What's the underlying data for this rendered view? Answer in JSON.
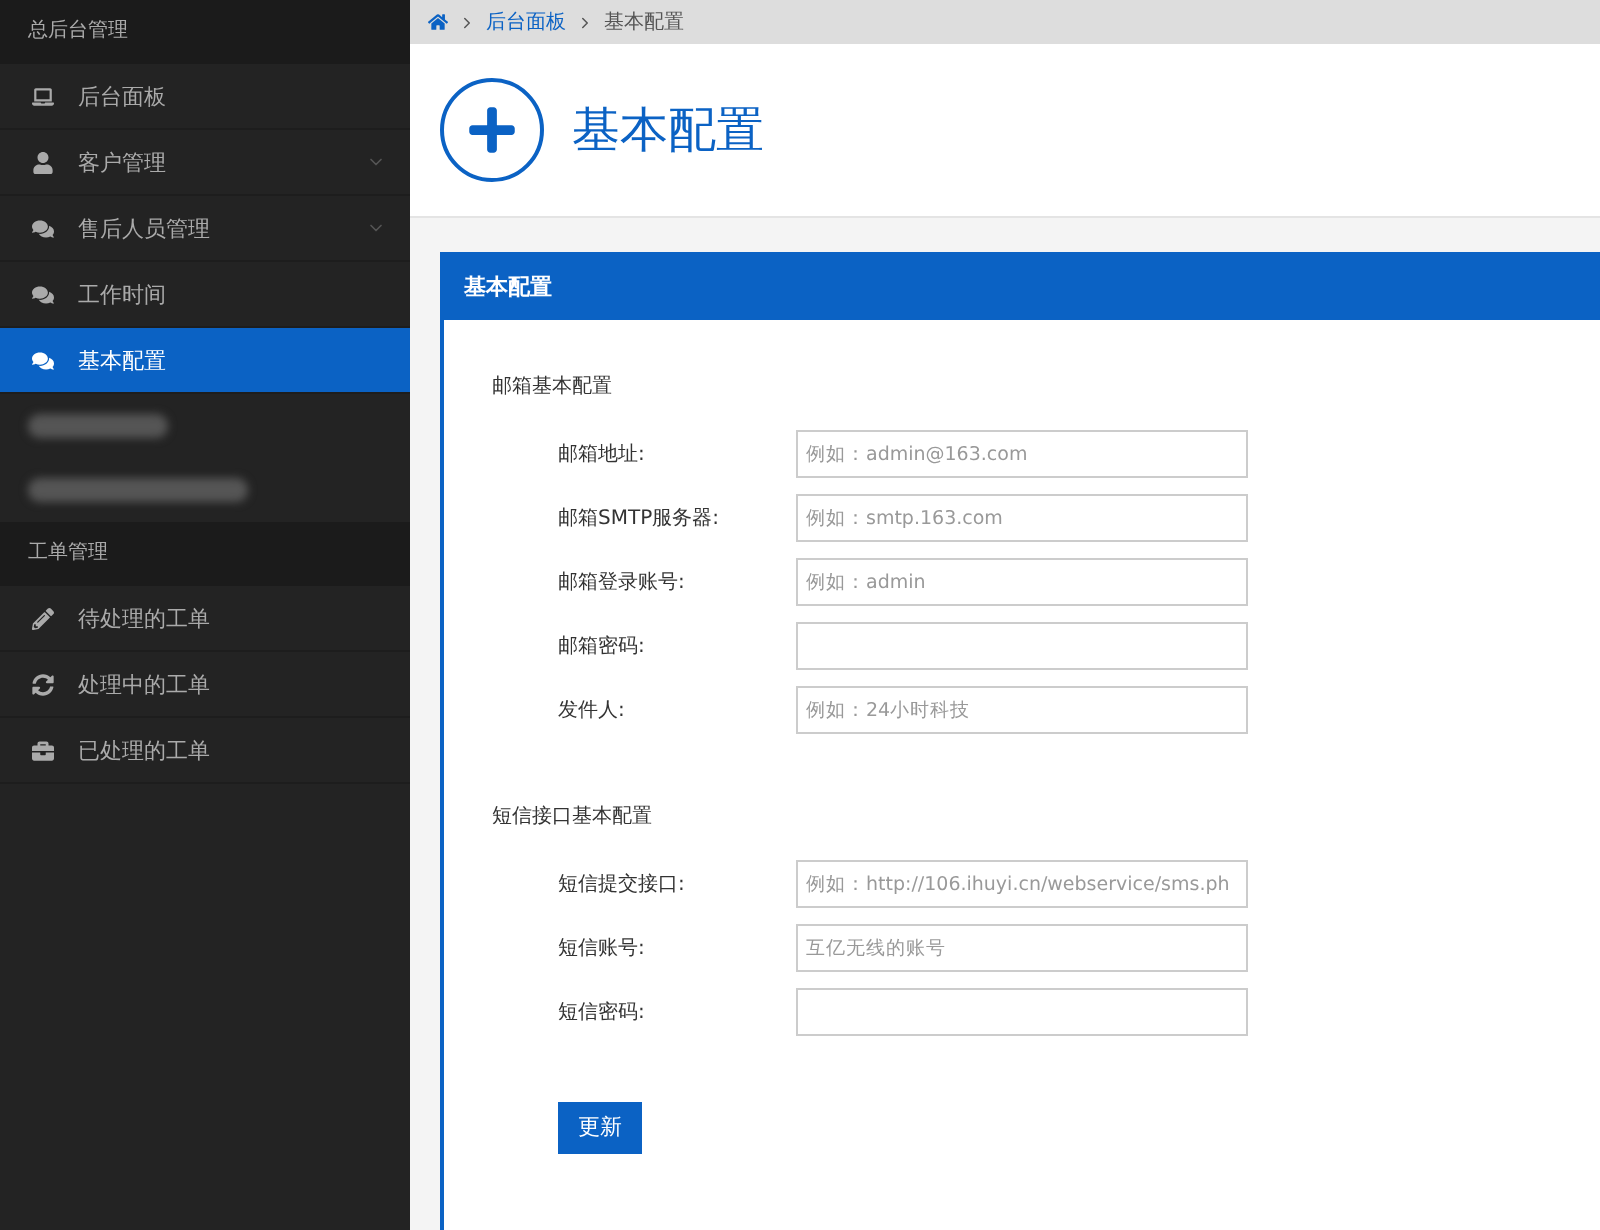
{
  "sidebar": {
    "sections": [
      {
        "title": "总后台管理",
        "items": [
          {
            "kind": "link",
            "label": "后台面板",
            "selected": false,
            "expandable": false
          },
          {
            "kind": "link",
            "label": "客户管理",
            "selected": false,
            "expandable": true
          },
          {
            "kind": "link",
            "label": "售后人员管理",
            "selected": false,
            "expandable": true
          },
          {
            "kind": "link",
            "label": "工作时间",
            "selected": false,
            "expandable": false
          },
          {
            "kind": "link",
            "label": "基本配置",
            "selected": true,
            "expandable": false
          },
          {
            "kind": "redacted"
          },
          {
            "kind": "redacted"
          }
        ]
      },
      {
        "title": "工单管理",
        "items": [
          {
            "kind": "link",
            "label": "待处理的工单",
            "selected": false,
            "expandable": false
          },
          {
            "kind": "link",
            "label": "处理中的工单",
            "selected": false,
            "expandable": false
          },
          {
            "kind": "link",
            "label": "已处理的工单",
            "selected": false,
            "expandable": false
          }
        ]
      }
    ]
  },
  "breadcrumb": [
    {
      "label": "后台面板",
      "link": true
    },
    {
      "label": "基本配置",
      "link": false
    }
  ],
  "page_title": "基本配置",
  "panel": {
    "title": "基本配置",
    "groups": [
      {
        "title": "邮箱基本配置",
        "fields": [
          {
            "label": "邮箱地址:",
            "placeholder": "例如：admin@163.com"
          },
          {
            "label": "邮箱SMTP服务器:",
            "placeholder": "例如：smtp.163.com"
          },
          {
            "label": "邮箱登录账号:",
            "placeholder": "例如：admin"
          },
          {
            "label": "邮箱密码:"
          },
          {
            "label": "发件人:",
            "placeholder": "例如：24小时科技"
          }
        ]
      },
      {
        "title": "短信接口基本配置",
        "fields": [
          {
            "label": "短信提交接口:",
            "placeholder": "例如：http://106.ihuyi.cn/webservice/sms.ph"
          },
          {
            "label": "短信账号:",
            "placeholder": "互亿无线的账号"
          },
          {
            "label": "短信密码:"
          }
        ]
      }
    ],
    "button": "更新"
  }
}
